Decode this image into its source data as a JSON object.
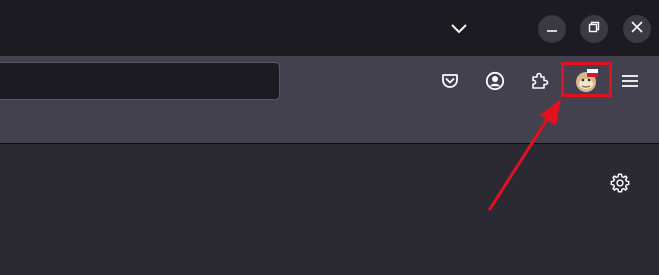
{
  "titlebar": {
    "list_all_tabs_icon": "chevron-down-icon",
    "window_controls": [
      "minimize",
      "restore",
      "close"
    ]
  },
  "urlbar": {
    "value": "",
    "placeholder": ""
  },
  "toolbar": {
    "icons": [
      "pocket-icon",
      "account-icon",
      "extensions-icon",
      "extension-avatar-icon",
      "menu-icon"
    ]
  },
  "content": {
    "settings_icon": "gear-icon"
  },
  "annotation": {
    "highlight_color": "#e1111f",
    "arrow_color": "#e1111f"
  }
}
